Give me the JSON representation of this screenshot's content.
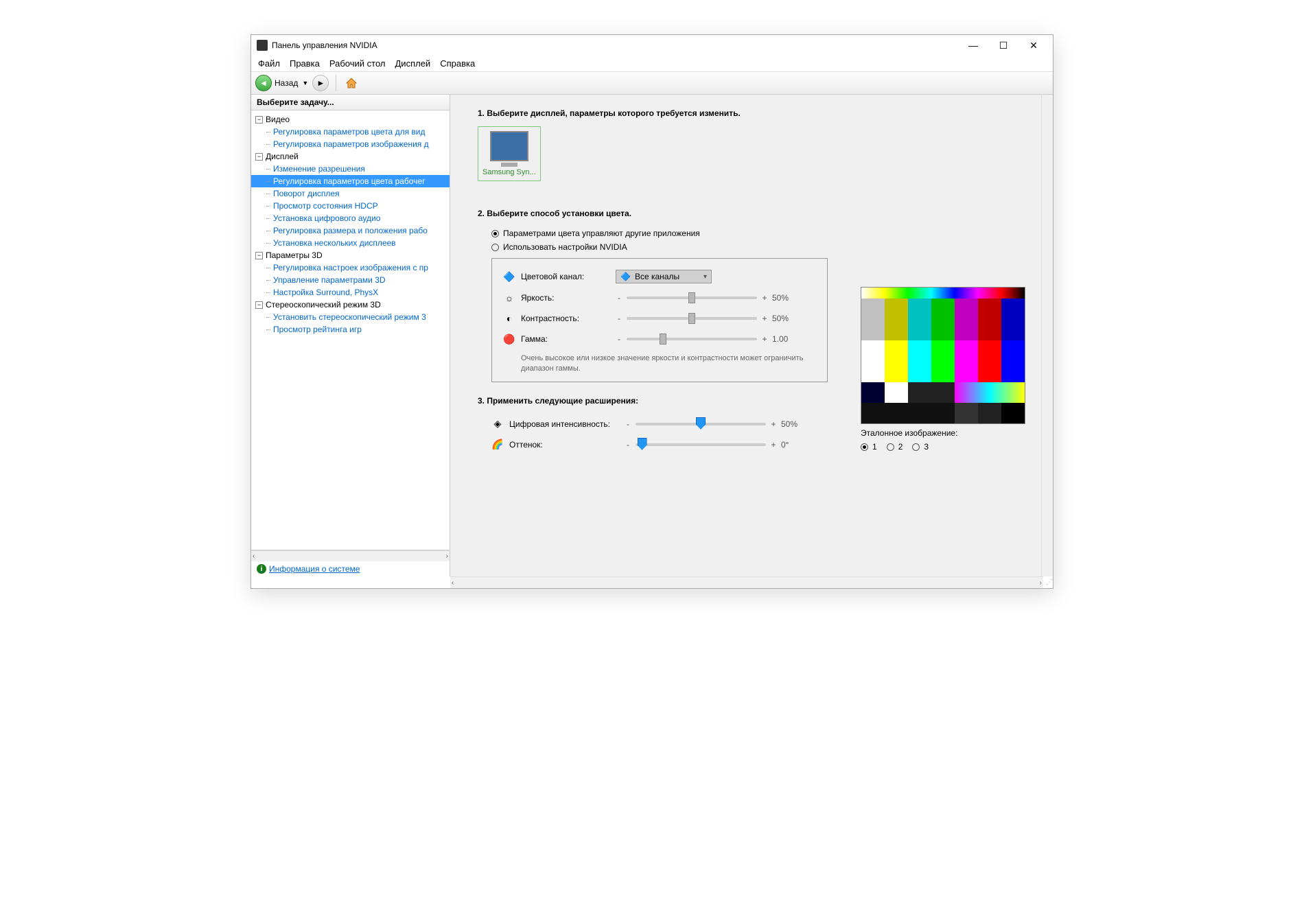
{
  "window": {
    "title": "Панель управления NVIDIA"
  },
  "menu": {
    "file": "Файл",
    "edit": "Правка",
    "desktop": "Рабочий стол",
    "display": "Дисплей",
    "help": "Справка"
  },
  "toolbar": {
    "back": "Назад"
  },
  "sidebar": {
    "header": "Выберите задачу...",
    "groups": [
      {
        "title": "Видео",
        "items": [
          "Регулировка параметров цвета для вид",
          "Регулировка параметров изображения д"
        ]
      },
      {
        "title": "Дисплей",
        "items": [
          "Изменение разрешения",
          "Регулировка параметров цвета рабочег",
          "Поворот дисплея",
          "Просмотр состояния HDCP",
          "Установка цифрового аудио",
          "Регулировка размера и положения рабо",
          "Установка нескольких дисплеев"
        ]
      },
      {
        "title": "Параметры 3D",
        "items": [
          "Регулировка настроек изображения с пр",
          "Управление параметрами 3D",
          "Настройка Surround, PhysX"
        ]
      },
      {
        "title": "Стереоскопический режим 3D",
        "items": [
          "Установить стереоскопический режим 3",
          "Просмотр рейтинга игр"
        ]
      }
    ],
    "selected": "Регулировка параметров цвета рабочег",
    "sysinfo": "Информация о системе"
  },
  "main": {
    "step1": {
      "title": "1. Выберите дисплей, параметры которого требуется изменить.",
      "display": "Samsung Syn..."
    },
    "step2": {
      "title": "2. Выберите способ установки цвета.",
      "radio_other": "Параметрами цвета управляют другие приложения",
      "radio_nvidia": "Использовать настройки NVIDIA",
      "channel_label": "Цветовой канал:",
      "channel_value": "Все каналы",
      "brightness": "Яркость:",
      "brightness_val": "50%",
      "contrast": "Контрастность:",
      "contrast_val": "50%",
      "gamma": "Гамма:",
      "gamma_val": "1.00",
      "hint": "Очень высокое или низкое значение яркости и контрастности может ограничить диапазон гаммы."
    },
    "step3": {
      "title": "3. Применить следующие расширения:",
      "vibrance": "Цифровая интенсивность:",
      "vibrance_val": "50%",
      "hue": "Оттенок:",
      "hue_val": "0°"
    },
    "ref": {
      "label": "Эталонное изображение:",
      "opt1": "1",
      "opt2": "2",
      "opt3": "3"
    }
  }
}
